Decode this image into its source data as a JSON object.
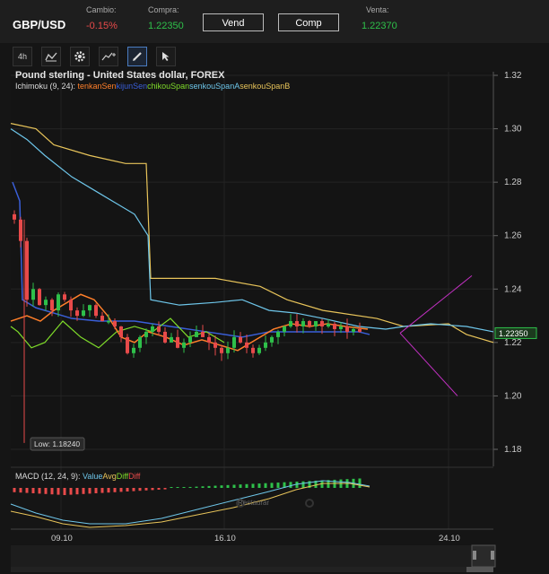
{
  "header": {
    "symbol": "GBP/USD",
    "change_label": "Cambio:",
    "change_value": "-0.15%",
    "buy_label": "Compra:",
    "buy_value": "1.22350",
    "sell_button": "Vend",
    "buy_button": "Comp",
    "sell_label": "Venta:",
    "sell_value": "1.22370"
  },
  "toolbar": {
    "timeframe": "4h",
    "items": [
      "chart-type-icon",
      "settings-gear-icon",
      "indicator-icon",
      "pencil-draw-icon",
      "cursor-arrow-icon"
    ]
  },
  "chart": {
    "title": "Pound sterling - United States dollar, FOREX",
    "ichimoku_prefix": "Ichimoku (9, 24): ",
    "ichimoku_series": [
      {
        "name": "tenkanSen",
        "color": "#ff7f2a"
      },
      {
        "name": "kijunSen",
        "color": "#3a5fd9"
      },
      {
        "name": "chikouSpan",
        "color": "#7fdc2a"
      },
      {
        "name": "senkouSpanA",
        "color": "#6ec6ea"
      },
      {
        "name": "senkouSpanB",
        "color": "#e8c45a"
      }
    ],
    "price_ticks": [
      "1.32",
      "1.30",
      "1.28",
      "1.26",
      "1.24",
      "1.22",
      "1.20",
      "1.18"
    ],
    "current_price": "1.22350",
    "low_label": "Low: 1.18240",
    "date_ticks": [
      "09.10",
      "16.10",
      "24.10"
    ],
    "macd_prefix": "MACD (12, 24, 9): ",
    "macd_series": [
      {
        "name": "Value",
        "color": "#6ec6ea"
      },
      {
        "name": "Avg",
        "color": "#e8c45a"
      },
      {
        "name": "Diff",
        "color": "#7fdc2a"
      },
      {
        "name": "Diff",
        "color": "#e84a4a"
      }
    ],
    "restore_label": "Restaurar",
    "colors": {
      "up": "#2ec04a",
      "down": "#e84a4a",
      "projection": "#c030c0"
    }
  }
}
